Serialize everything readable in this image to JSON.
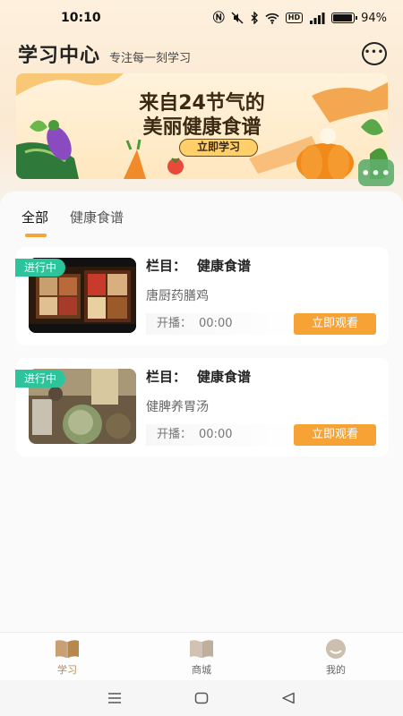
{
  "status_bar": {
    "time": "10:10",
    "battery": "94%",
    "battery_level": 0.94,
    "icons": [
      "nfc-icon",
      "mute-icon",
      "bluetooth-icon",
      "wifi-icon",
      "hd-icon",
      "signal-icon",
      "battery-icon"
    ]
  },
  "header": {
    "title": "学习中心",
    "subtitle": "专注每一刻学习",
    "chat_icon": "chat-bubble-icon"
  },
  "banner": {
    "title_line1": "来自24节气的",
    "title_line2": "美丽健康食谱",
    "button": "立即学习"
  },
  "tabs": [
    {
      "label": "全部",
      "active": true
    },
    {
      "label": "健康食谱",
      "active": false
    }
  ],
  "cards": [
    {
      "badge": "进行中",
      "column_label": "栏目：",
      "column_value": "健康食谱",
      "name": "唐厨药膳鸡",
      "start_label": "开播：",
      "start_time": "00:00",
      "button": "立即观看"
    },
    {
      "badge": "进行中",
      "column_label": "栏目：",
      "column_value": "健康食谱",
      "name": "健脾养胃汤",
      "start_label": "开播：",
      "start_time": "00:00",
      "button": "立即观看"
    }
  ],
  "bottom_nav": [
    {
      "label": "学习",
      "icon": "book-icon",
      "active": true
    },
    {
      "label": "商城",
      "icon": "book-icon",
      "active": false
    },
    {
      "label": "我的",
      "icon": "face-icon",
      "active": false
    }
  ],
  "colors": {
    "accent": "#f6a234",
    "badge": "#2ec49b",
    "nav_active": "#b8874e"
  }
}
